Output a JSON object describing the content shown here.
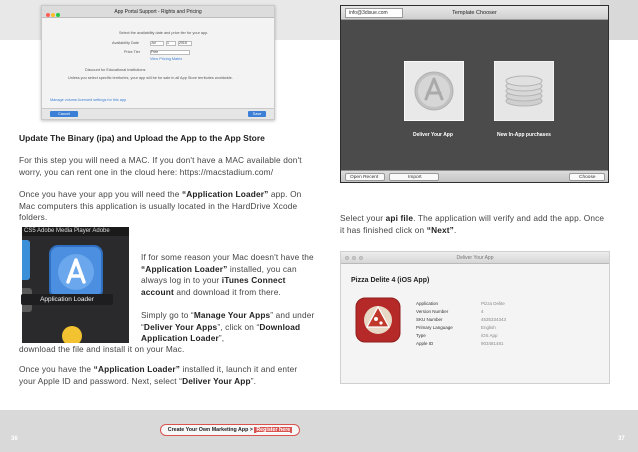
{
  "portal_screenshot": {
    "title": "App Portal Support - Rights and Pricing",
    "instruction": "Select the availability date and price tier for your app.",
    "availability_label": "Availability Date",
    "date_month": "Jul",
    "date_day": "1",
    "date_year": "2015",
    "price_tier_label": "Price Tier",
    "price_tier_value": "Free",
    "matrix_link": "View Pricing Matrix",
    "discount_label": "Discount for Educational Institutions",
    "territories_text": "Unless you select specific territories, your app will be for sale in all App Store territories worldwide.",
    "footer_link": "Manage volume-licensed settings for this app",
    "cancel_label": "Cancel",
    "save_label": "Save"
  },
  "template_chooser": {
    "email": "info@3disue.com",
    "title": "Template Chooser",
    "deliver_label": "Deliver Your App",
    "inapp_label": "New In-App purchases",
    "open_recent_label": "Open Recent",
    "import_label": "Import",
    "choose_label": "Choose"
  },
  "left_text": {
    "heading": "Update The Binary (ipa) and Upload the App to the App Store",
    "p1": "For this step you will need a MAC. If you don't have a MAC available don't worry, you can rent one in the cloud here: https://macstadium.com/",
    "p2_a": "Once you have your app you will need the ",
    "p2_b": "“Application Loader”",
    "p2_c": " app. On Mac computers this application is usually located in the HardDrive Xcode folders.",
    "p3_a": "If for some reason your Mac doesn't have the ",
    "p3_b": "“Application Loader”",
    "p3_c": " installed, you can always log in to your ",
    "p3_d": "iTunes Connect account",
    "p3_e": " and download it from there.",
    "p4_a": "Simply go to “",
    "p4_b": "Manage Your Apps",
    "p4_c": "” and under “",
    "p4_d": "Deliver Your Apps",
    "p4_e": "”, click on “",
    "p4_f": "Download Application Loader",
    "p4_g": "”,",
    "p4_h": "download the file and install it on your Mac.",
    "p5_a": "Once you have the ",
    "p5_b": "“Application Loader”",
    "p5_c": " installed it, launch it and enter your Apple ID and password. Next, select “",
    "p5_d": "Deliver Your App",
    "p5_e": "”."
  },
  "dock": {
    "top_text": "CS5  Adobe Media Player  Adobe",
    "app_label": "Application Loader"
  },
  "right_text": {
    "a": "Select your ",
    "b": "api file",
    "c": ". The application will verify and add the app. Once it has finished click on ",
    "d": "“Next”",
    "e": "."
  },
  "pizza_app": {
    "window_title": "Deliver Your App",
    "app_name": "Pizza Delite 4 (iOS App)",
    "rows": [
      {
        "label": "Application",
        "value": "Pizza Delite"
      },
      {
        "label": "Version Number",
        "value": "4"
      },
      {
        "label": "SKU Number",
        "value": "4535334343"
      },
      {
        "label": "Primary Language",
        "value": "English"
      },
      {
        "label": "Type",
        "value": "iOS App"
      },
      {
        "label": "Apple ID",
        "value": "903481481"
      }
    ]
  },
  "footer": {
    "page_left": "36",
    "page_right": "37",
    "pill_text": "Create Your Own Marketing App > ",
    "pill_link": "Register here"
  },
  "colors": {
    "accent_red": "#d9534f",
    "mac_blue": "#3c7fd6"
  }
}
